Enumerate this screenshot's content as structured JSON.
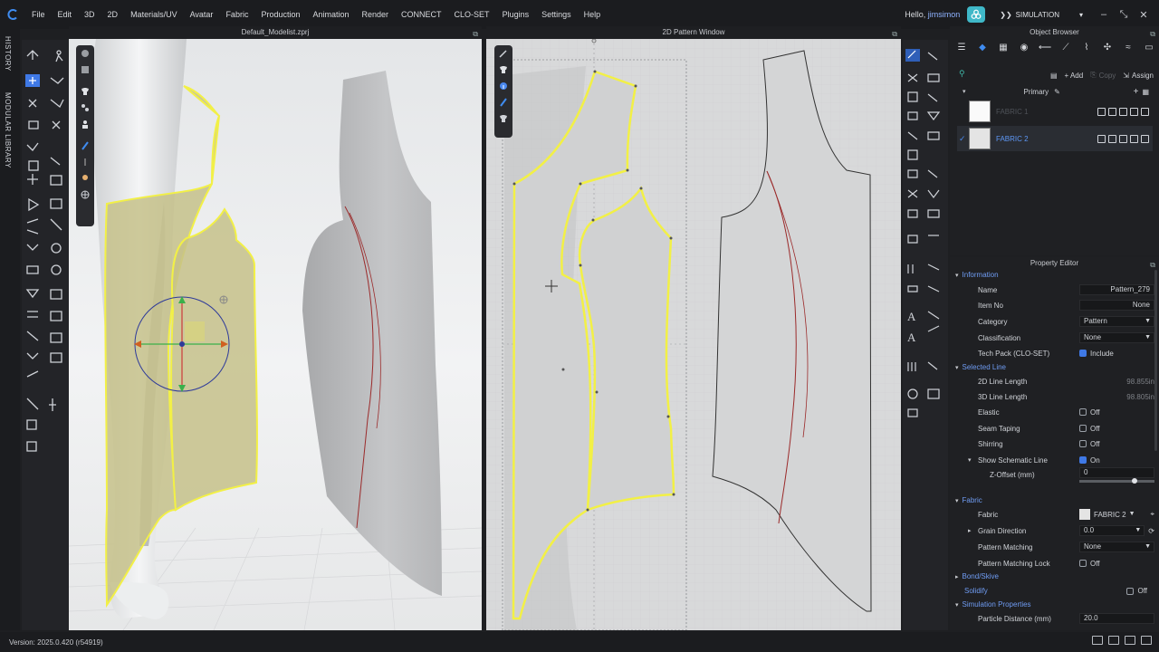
{
  "menubar": {
    "logo": "clo-logo-icon",
    "items": [
      "File",
      "Edit",
      "3D",
      "2D",
      "Materials/UV",
      "Avatar",
      "Fabric",
      "Production",
      "Animation",
      "Render",
      "CONNECT",
      "CLO-SET",
      "Plugins",
      "Settings",
      "Help"
    ],
    "greeting": "Hello, ",
    "user": "jimsimon",
    "mode": "SIMULATION"
  },
  "sidetabs": {
    "history": "HISTORY",
    "modular_library": "MODULAR LIBRARY"
  },
  "window3d": {
    "title": "Default_Modelist.zprj"
  },
  "window2d": {
    "title": "2D Pattern Window"
  },
  "object_browser": {
    "title": "Object Browser",
    "actions": {
      "add": "+ Add",
      "copy": "Copy",
      "assign": "Assign"
    },
    "group_label": "Primary",
    "fabrics": [
      {
        "name": "FABRIC 1",
        "selected": false
      },
      {
        "name": "FABRIC 2",
        "selected": true
      }
    ]
  },
  "property_editor": {
    "title": "Property Editor",
    "information": {
      "header": "Information",
      "name_label": "Name",
      "name_value": "Pattern_279",
      "item_no_label": "Item No",
      "item_no_value": "None",
      "category_label": "Category",
      "category_value": "Pattern",
      "classification_label": "Classification",
      "classification_value": "None",
      "techpack_label": "Tech Pack (CLO-SET)",
      "techpack_value": "Include"
    },
    "selected_line": {
      "header": "Selected Line",
      "len2d_label": "2D Line Length",
      "len2d_value": "98.855in",
      "len3d_label": "3D Line Length",
      "len3d_value": "98.805in",
      "elastic_label": "Elastic",
      "elastic_value": "Off",
      "seam_label": "Seam Taping",
      "seam_value": "Off",
      "shirring_label": "Shirring",
      "shirring_value": "Off",
      "schematic_label": "Show Schematic Line",
      "schematic_value": "On",
      "zoffset_label": "Z-Offset (mm)",
      "zoffset_value": "0"
    },
    "fabric": {
      "header": "Fabric",
      "fabric_label": "Fabric",
      "fabric_value": "FABRIC 2",
      "grain_label": "Grain Direction",
      "grain_value": "0.0",
      "matching_label": "Pattern Matching",
      "matching_value": "None",
      "lock_label": "Pattern Matching Lock",
      "lock_value": "Off"
    },
    "bond": {
      "header": "Bond/Skive"
    },
    "solidify": {
      "header": "Solidify",
      "value": "Off"
    },
    "simulation": {
      "header": "Simulation Properties",
      "particle_label": "Particle Distance (mm)",
      "particle_value": "20.0"
    }
  },
  "statusbar": {
    "version": "Version: 2025.0.420 (r54919)"
  },
  "colors": {
    "accent": "#3f79e6",
    "selection_yellow": "#f2f046",
    "pattern_fill": "#c5c18a",
    "seam_red": "#9b2a2a"
  }
}
